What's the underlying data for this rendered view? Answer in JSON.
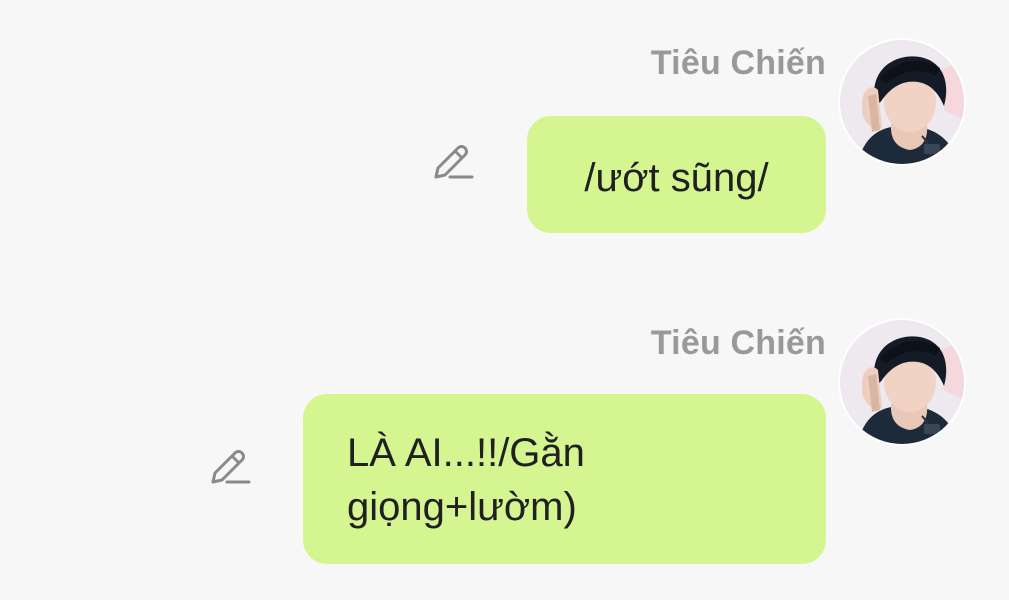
{
  "messages": [
    {
      "sender": "Tiêu Chiến",
      "text": "/ướt sũng/",
      "avatar_icon": "avatar-photo",
      "edit_icon": "pencil-icon"
    },
    {
      "sender": "Tiêu Chiến",
      "text": "LÀ AI...!!/Gằn giọng+lườm)",
      "avatar_icon": "avatar-photo",
      "edit_icon": "pencil-icon"
    }
  ],
  "colors": {
    "background": "#f7f7f7",
    "bubble": "#d5f591",
    "sender_name": "#999999",
    "text": "#202020",
    "icon": "#8a8a8a"
  }
}
